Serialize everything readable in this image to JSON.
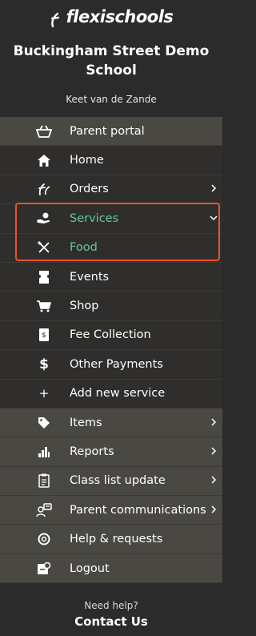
{
  "brand": {
    "logo_text": "flexischools"
  },
  "header": {
    "school_name": "Buckingham Street Demo School",
    "user_name": "Keet van de Zande"
  },
  "menu": [
    {
      "label": "Parent portal",
      "icon": "basket-icon"
    },
    {
      "label": "Home",
      "icon": "home-icon"
    },
    {
      "label": "Orders",
      "icon": "flexi-icon",
      "chevron": "right"
    },
    {
      "label": "Services",
      "icon": "hand-service-icon",
      "chevron": "down",
      "active": true
    },
    {
      "label": "Food",
      "icon": "utensils-icon",
      "active": true
    },
    {
      "label": "Events",
      "icon": "ticket-icon"
    },
    {
      "label": "Shop",
      "icon": "cart-icon"
    },
    {
      "label": "Fee Collection",
      "icon": "receipt-icon"
    },
    {
      "label": "Other Payments",
      "icon": "dollar-icon"
    },
    {
      "label": "Add new service",
      "icon": "plus-icon"
    },
    {
      "label": "Items",
      "icon": "tag-icon",
      "chevron": "right"
    },
    {
      "label": "Reports",
      "icon": "bar-chart-icon",
      "chevron": "right"
    },
    {
      "label": "Class list update",
      "icon": "clipboard-icon",
      "chevron": "right"
    },
    {
      "label": "Parent communications",
      "icon": "chat-user-icon",
      "chevron": "right"
    },
    {
      "label": "Help & requests",
      "icon": "lifebuoy-icon"
    },
    {
      "label": "Logout",
      "icon": "logout-icon"
    }
  ],
  "footer": {
    "need_help": "Need help?",
    "contact": "Contact Us"
  },
  "colors": {
    "accent": "#5fc9a1",
    "highlight": "#e8542a",
    "background": "#2b2b2b",
    "menu_band": "#4a4842"
  }
}
